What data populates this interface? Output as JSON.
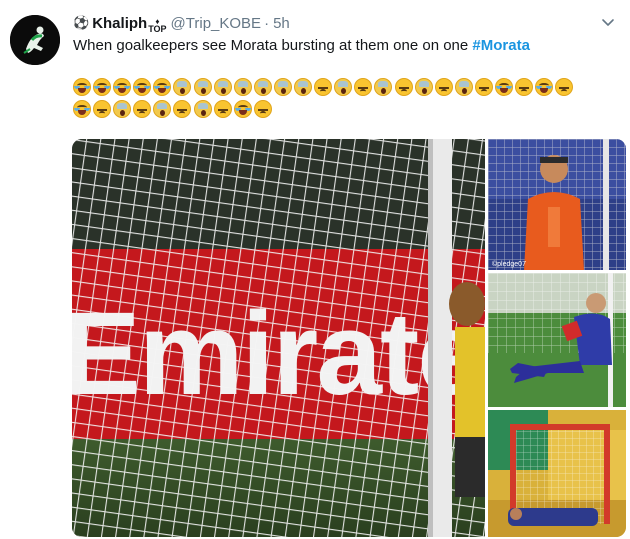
{
  "tweet": {
    "name_icon": "soccer-ball-icon",
    "display_name": "Khaliph",
    "name_suffix": "TOP",
    "handle": "@Trip_KOBE",
    "separator": "·",
    "time": "5h",
    "text": "When goalkeepers see Morata bursting at them one on one ",
    "hashtag": "#Morata",
    "emoji_row1": [
      "joy",
      "joy",
      "joy",
      "joy",
      "joy",
      "scream",
      "scream",
      "scream",
      "scream",
      "scream",
      "scream",
      "scream",
      "tired",
      "scream",
      "tired",
      "scream",
      "tired",
      "scream",
      "tired",
      "scream",
      "tired",
      "joy",
      "tired",
      "joy",
      "tired"
    ],
    "emoji_row2": [
      "joy",
      "tired",
      "scream",
      "tired",
      "scream",
      "tired",
      "scream",
      "tired",
      "joy",
      "tired"
    ]
  },
  "media": {
    "main_image_text": "Emirates",
    "side_image_1_caption": "©pledge07"
  },
  "colors": {
    "hashtag": "#1b95e0",
    "secondary_text": "#657786",
    "primary_text": "#14171a"
  }
}
